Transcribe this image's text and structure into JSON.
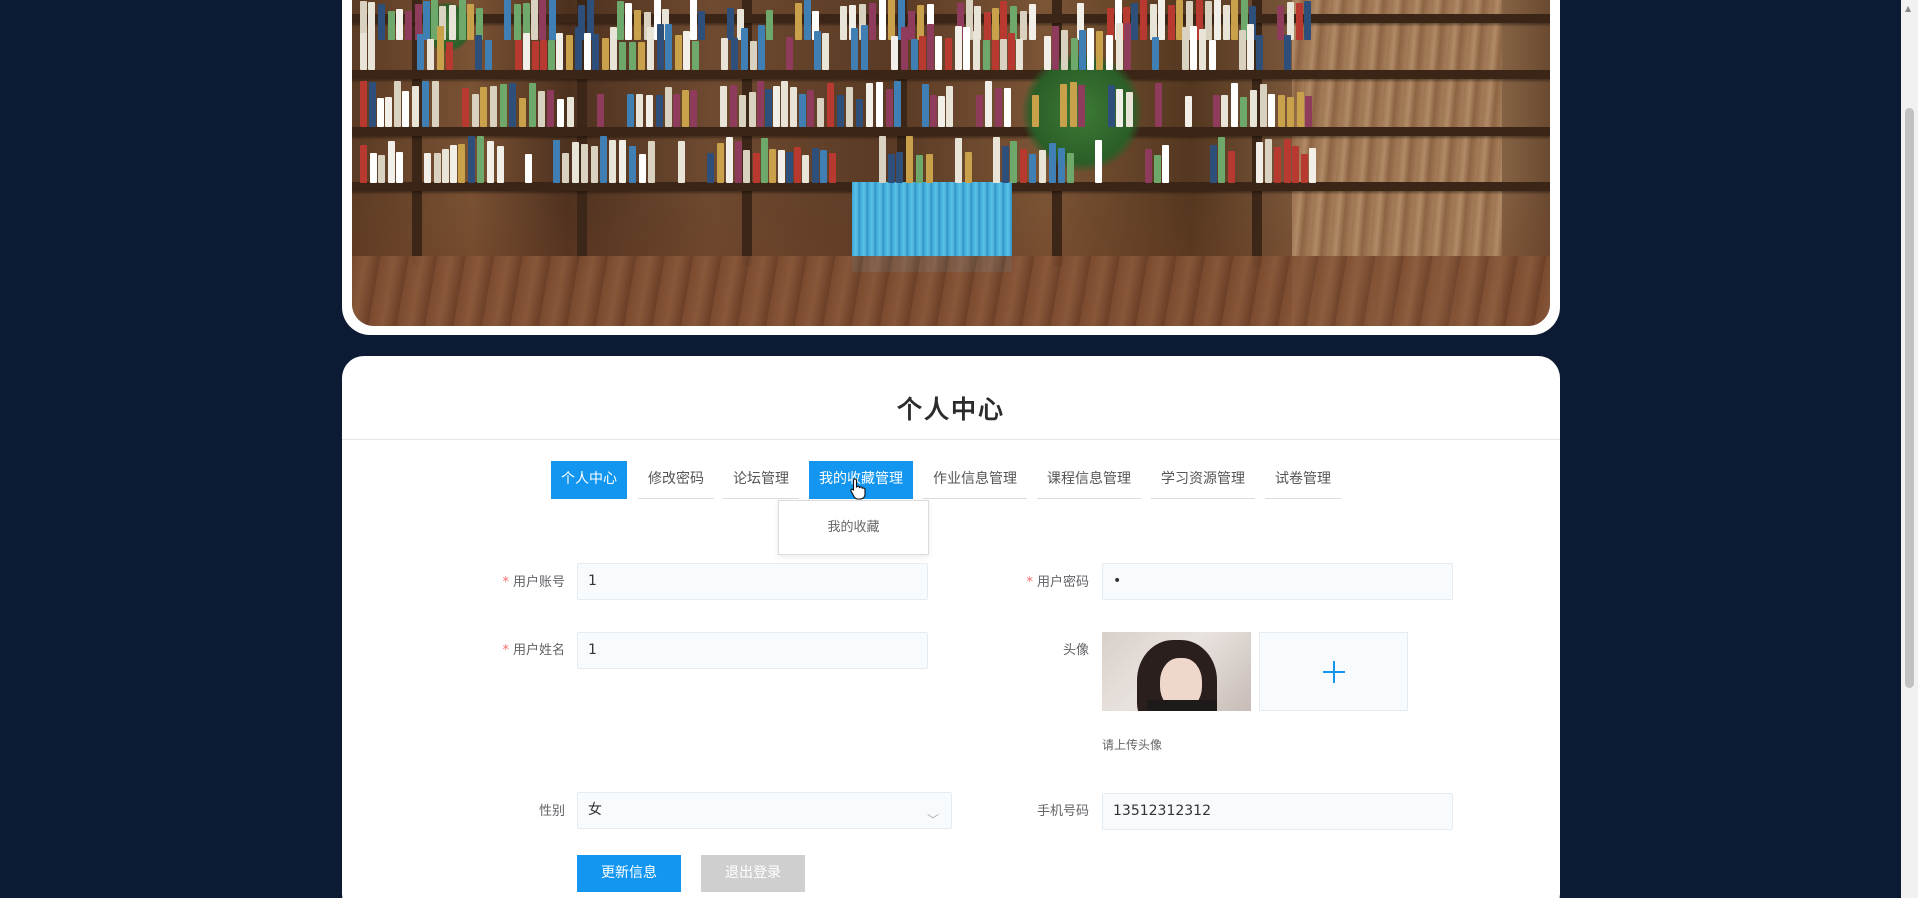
{
  "page": {
    "title": "个人中心"
  },
  "tabs": [
    {
      "label": "个人中心",
      "active": true
    },
    {
      "label": "修改密码",
      "active": false
    },
    {
      "label": "论坛管理",
      "active": false
    },
    {
      "label": "我的收藏管理",
      "active": true
    },
    {
      "label": "作业信息管理",
      "active": false
    },
    {
      "label": "课程信息管理",
      "active": false
    },
    {
      "label": "学习资源管理",
      "active": false
    },
    {
      "label": "试卷管理",
      "active": false
    }
  ],
  "dropdown": {
    "items": [
      "我的收藏"
    ]
  },
  "form": {
    "account": {
      "label": "用户账号",
      "value": "1",
      "required": true
    },
    "password": {
      "label": "用户密码",
      "value": "•",
      "required": true
    },
    "name": {
      "label": "用户姓名",
      "value": "1",
      "required": true
    },
    "avatar": {
      "label": "头像",
      "hint": "请上传头像",
      "icon": "plus-icon"
    },
    "gender": {
      "label": "性别",
      "value": "女",
      "icon": "chevron-down-icon"
    },
    "phone": {
      "label": "手机号码",
      "value": "13512312312"
    }
  },
  "buttons": {
    "update": "更新信息",
    "logout": "退出登录"
  },
  "colors": {
    "accent": "#1296f0",
    "background": "#0c1a33",
    "required": "#f56c6c",
    "disabled": "#cfcfcf"
  }
}
